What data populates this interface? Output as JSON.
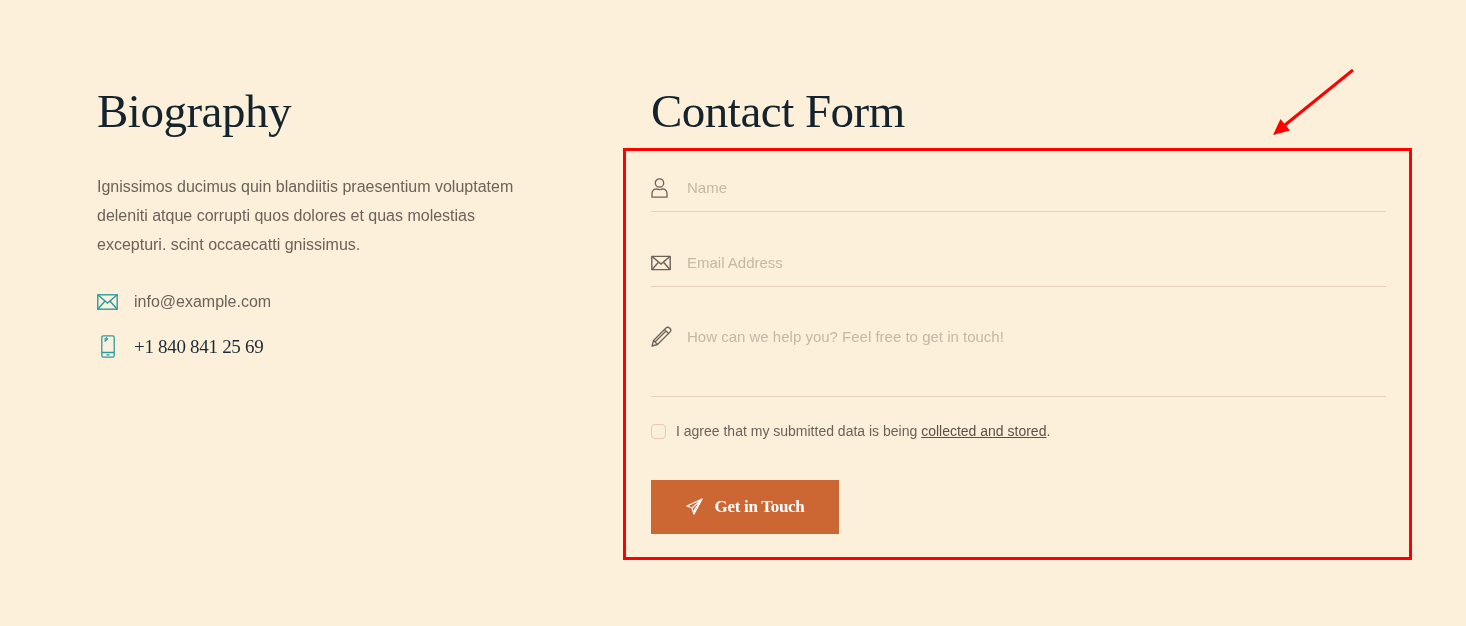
{
  "biography": {
    "title": "Biography",
    "text": "Ignissimos ducimus quin blandiitis praesentium voluptatem deleniti atque corrupti quos dolores et quas molestias excepturi. scint occaecatti gnissimus.",
    "contacts": [
      {
        "kind": "email",
        "text": "info@example.com"
      },
      {
        "kind": "phone",
        "text": "+1 840 841 25 69"
      }
    ]
  },
  "contact_form": {
    "title": "Contact Form",
    "highlighted": true,
    "fields": [
      {
        "kind": "name",
        "placeholder": "Name"
      },
      {
        "kind": "email",
        "placeholder": "Email Address"
      },
      {
        "kind": "message",
        "placeholder": "How can we help you? Feel free to get in touch!"
      }
    ],
    "consent": {
      "checked": false,
      "text": "I agree that my submitted data is being",
      "link": "collected and stored",
      "after": "."
    },
    "submit_button": {
      "label": "Get in Touch"
    }
  }
}
